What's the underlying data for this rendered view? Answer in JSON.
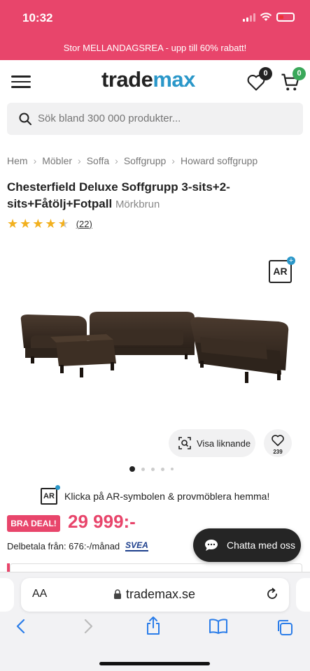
{
  "status_bar": {
    "time": "10:32"
  },
  "promo": {
    "text": "Stor MELLANDAGSREA - upp till 60% rabatt!"
  },
  "header": {
    "logo_part1": "trade",
    "logo_part2": "max",
    "wishlist_count": "0",
    "cart_count": "0"
  },
  "search": {
    "placeholder": "Sök bland 300 000 produkter..."
  },
  "breadcrumb": [
    "Hem",
    "Möbler",
    "Soffa",
    "Soffgrupp",
    "Howard soffgrupp"
  ],
  "product": {
    "title": "Chesterfield Deluxe Soffgrupp 3-sits+2-sits+Fåtölj+Fotpall",
    "variant": "Mörkbrun",
    "rating": 4.5,
    "review_count": "(22)",
    "ar_label": "AR",
    "similar_label": "Visa liknande",
    "wish_count": "239",
    "image_count": 5,
    "active_image": 1
  },
  "ar_promo": {
    "label": "AR",
    "text": "Klicka på AR-symbolen & provmöblera hemma!"
  },
  "pricing": {
    "deal_badge": "BRA DEAL!",
    "price": "29 999:-",
    "installment": "Delbetala från: 676:-/månad",
    "partner": "SVEA"
  },
  "chat": {
    "label": "Chatta med oss"
  },
  "browser": {
    "text_size": "AA",
    "url": "trademax.se"
  },
  "colors": {
    "brand_pink": "#e8456b",
    "logo_accent": "#2a97c9",
    "star": "#f2b01e",
    "cart_badge": "#3aa85a"
  },
  "icons": [
    "menu-icon",
    "heart-icon",
    "cart-icon",
    "search-icon",
    "ar-icon",
    "visual-search-icon",
    "chat-icon",
    "lock-icon",
    "reload-icon",
    "back-icon",
    "forward-icon",
    "share-icon",
    "bookmarks-icon",
    "tabs-icon"
  ]
}
